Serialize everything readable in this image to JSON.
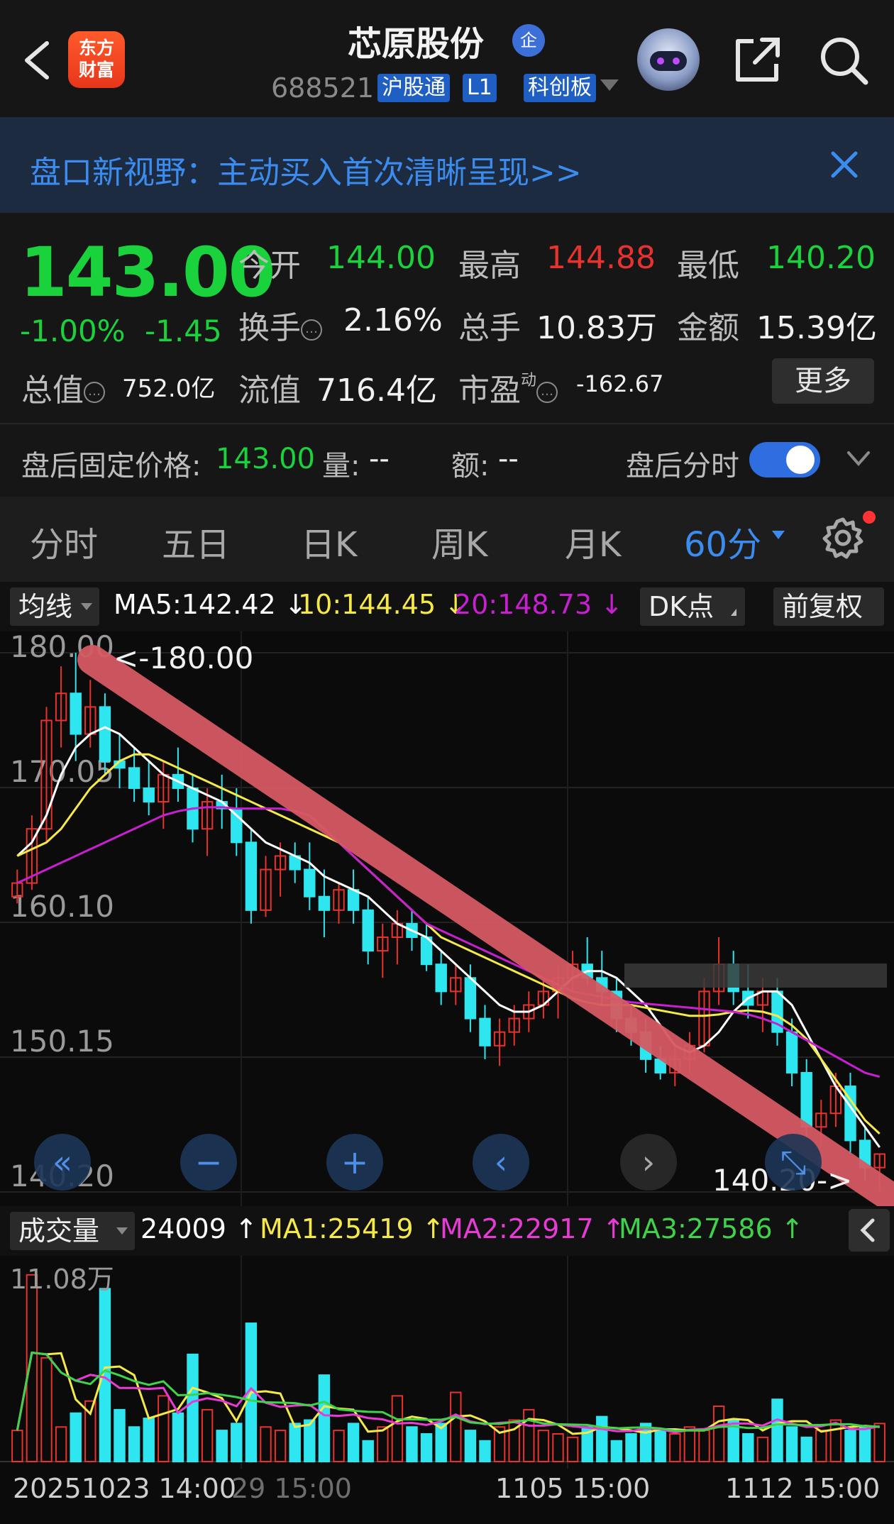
{
  "header": {
    "stock_name": "芯原股份",
    "qi_badge": "企",
    "stock_code": "688521",
    "tags": [
      "沪股通",
      "L1",
      "科创板"
    ],
    "logo_lines": [
      "东方",
      "财富"
    ],
    "icons": [
      "back-icon",
      "robot-avatar-icon",
      "share-icon",
      "search-icon"
    ]
  },
  "banner": {
    "text": "盘口新视野：主动买入首次清晰呈现>>",
    "close_icon": "close-icon"
  },
  "quote": {
    "price": "143.00",
    "change_pct": "-1.00%",
    "change": "-1.45",
    "open_label": "今开",
    "open": "144.00",
    "high_label": "最高",
    "high": "144.88",
    "low_label": "最低",
    "low": "140.20",
    "turnover_label": "换手",
    "turnover": "2.16%",
    "volume_label": "总手",
    "volume": "10.83万",
    "amount_label": "金额",
    "amount": "15.39亿",
    "mktcap_label": "总值",
    "mktcap": "752.0亿",
    "float_label": "流值",
    "float": "716.4亿",
    "pe_label": "市盈",
    "pe_sup": "动",
    "pe": "-162.67",
    "more_label": "更多",
    "colors": {
      "down": "#19d23c",
      "up": "#e8322d"
    }
  },
  "after_hours": {
    "fixed_label": "盘后固定价格:",
    "fixed_price": "143.00",
    "vol_label": "量:",
    "vol": "--",
    "amt_label": "额:",
    "amt": "--",
    "toggle_label": "盘后分时",
    "toggle_on": true
  },
  "tabs": {
    "items": [
      "分时",
      "五日",
      "日K",
      "周K",
      "月K",
      "60分"
    ],
    "active": "60分"
  },
  "ma_bar": {
    "select": "均线",
    "ma5": "MA5:142.42 ↓",
    "ma10": "10:144.45 ↓",
    "ma20": "20:148.73 ↓",
    "dk": "DK点",
    "adjust": "前复权",
    "colors": {
      "ma5": "#ffffff",
      "ma10": "#f5e94a",
      "ma20": "#c81fd1"
    }
  },
  "chart": {
    "y_ticks": [
      "180.00",
      "170.05",
      "160.10",
      "150.15",
      "140.20"
    ],
    "max_marker": "<-180.00",
    "min_marker": "140.20->",
    "nav_icons": [
      "double-left-icon",
      "zoom-out-icon",
      "zoom-in-icon",
      "prev-icon",
      "next-icon",
      "fullscreen-icon"
    ]
  },
  "volume_bar": {
    "select": "成交量",
    "vol": "24009 ↑",
    "ma1": "MA1:25419 ↑",
    "ma2": "MA2:22917 ↑",
    "ma3": "MA3:27586 ↑",
    "max_label": "11.08万",
    "colors": {
      "ma1": "#f5e94a",
      "ma2": "#e83bd4",
      "ma3": "#3fd24a"
    }
  },
  "x_labels": [
    "20251023 14:00",
    "29 15:00",
    "1105 15:00",
    "1112 15:00"
  ],
  "chart_data": {
    "type": "candlestick",
    "ylim": [
      140.2,
      180.0
    ],
    "y_ticks": [
      180.0,
      170.05,
      160.1,
      150.15,
      140.2
    ],
    "candles_ohlc": [
      [
        162,
        164,
        161.5,
        163
      ],
      [
        163,
        168,
        162.5,
        167
      ],
      [
        167,
        176,
        166,
        175
      ],
      [
        175,
        179,
        173,
        177
      ],
      [
        177,
        180,
        172,
        174
      ],
      [
        174,
        178,
        173,
        176
      ],
      [
        176,
        177,
        171,
        172
      ],
      [
        172,
        174,
        170,
        171.5
      ],
      [
        171.5,
        173,
        169,
        170
      ],
      [
        170,
        172,
        168,
        169
      ],
      [
        169,
        172,
        167,
        171
      ],
      [
        171,
        173,
        169,
        170
      ],
      [
        170,
        171,
        166,
        167
      ],
      [
        167,
        170,
        165,
        169
      ],
      [
        169,
        171,
        167,
        168.5
      ],
      [
        168.5,
        170,
        165,
        166
      ],
      [
        166,
        167,
        160,
        161
      ],
      [
        161,
        165,
        160.5,
        164
      ],
      [
        164,
        166,
        162,
        165
      ],
      [
        165,
        166,
        163,
        164
      ],
      [
        164,
        166,
        161,
        162
      ],
      [
        162,
        164,
        159,
        161
      ],
      [
        161,
        163,
        160,
        162.5
      ],
      [
        162.5,
        164,
        160,
        161
      ],
      [
        161,
        162,
        157,
        158
      ],
      [
        158,
        160,
        156,
        159
      ],
      [
        159,
        161,
        157,
        160
      ],
      [
        160,
        161,
        158,
        159
      ],
      [
        159,
        160,
        156.5,
        157
      ],
      [
        157,
        158,
        154,
        155
      ],
      [
        155,
        157,
        154,
        156
      ],
      [
        156,
        157,
        152,
        153
      ],
      [
        153,
        154,
        150,
        151
      ],
      [
        151,
        153,
        149.5,
        152
      ],
      [
        152,
        154,
        151,
        153
      ],
      [
        153,
        155,
        152,
        154
      ],
      [
        154,
        156,
        153,
        155
      ],
      [
        155,
        157,
        153,
        156
      ],
      [
        156,
        158,
        155,
        157
      ],
      [
        157,
        159,
        155.5,
        156
      ],
      [
        156,
        158,
        154,
        155
      ],
      [
        155,
        156,
        152,
        153
      ],
      [
        153,
        154,
        151,
        152
      ],
      [
        152,
        153,
        149,
        150
      ],
      [
        150,
        151,
        148.5,
        149
      ],
      [
        149,
        151,
        148,
        150
      ],
      [
        150,
        152,
        149,
        151
      ],
      [
        151,
        156,
        150.5,
        155
      ],
      [
        155,
        159,
        154,
        157
      ],
      [
        157,
        158,
        154,
        155
      ],
      [
        155,
        157,
        153,
        154
      ],
      [
        154,
        156,
        152,
        155
      ],
      [
        155,
        156,
        151,
        152
      ],
      [
        152,
        153,
        148,
        149
      ],
      [
        149,
        150,
        144,
        145
      ],
      [
        145,
        147,
        143.5,
        146
      ],
      [
        146,
        149,
        145,
        148
      ],
      [
        148,
        149,
        143,
        144
      ],
      [
        144,
        145,
        141,
        142
      ],
      [
        142,
        143,
        140.2,
        143
      ]
    ],
    "series": [
      {
        "name": "MA5",
        "values": [
          165,
          166,
          168,
          171,
          173,
          174,
          174.5,
          174,
          173,
          172,
          171,
          170.5,
          170,
          169.5,
          169,
          168,
          167,
          166,
          165.5,
          165,
          164.5,
          163.5,
          163,
          162.5,
          162,
          161,
          160,
          159.5,
          159,
          158,
          157,
          156,
          155,
          154,
          153.5,
          153.5,
          154,
          155,
          156,
          156.5,
          156.5,
          156,
          155,
          154,
          152.5,
          151,
          150.5,
          151,
          152,
          153.5,
          154.5,
          155,
          155,
          154,
          152,
          150,
          148,
          146.5,
          145,
          143.5
        ]
      },
      {
        "name": "10",
        "values": [
          165,
          165.5,
          166,
          167,
          168.5,
          170,
          171,
          172,
          172.5,
          172.5,
          172,
          171.5,
          171,
          170.5,
          170,
          169.5,
          169,
          168.5,
          168,
          167.5,
          167,
          166.5,
          166,
          165,
          164,
          163,
          162,
          161,
          160,
          159,
          158.5,
          158,
          157.5,
          157,
          156.5,
          156,
          155.5,
          155,
          154.5,
          154.2,
          154,
          154,
          154,
          153.8,
          153.6,
          153.4,
          153.2,
          153.2,
          153.3,
          153.5,
          153.6,
          153.5,
          153.2,
          152.5,
          151.5,
          150,
          148.5,
          147,
          145.5,
          144.5
        ]
      },
      {
        "name": "20",
        "values": [
          163,
          163.5,
          164,
          164.5,
          165,
          165.5,
          166,
          166.5,
          167,
          167.5,
          168,
          168.3,
          168.5,
          168.6,
          168.6,
          168.5,
          168.5,
          168.5,
          168.5,
          168.3,
          168,
          167,
          166,
          165,
          164,
          163,
          162,
          161,
          160,
          159.5,
          159,
          158.5,
          158,
          157.5,
          157,
          156.5,
          156,
          155.5,
          155,
          154.8,
          154.6,
          154.4,
          154.2,
          154.1,
          154,
          153.9,
          153.8,
          153.7,
          153.6,
          153.5,
          153.3,
          153,
          152.6,
          152,
          151.4,
          150.8,
          150.2,
          149.6,
          149,
          148.7
        ]
      }
    ],
    "volume": {
      "max": 110800,
      "ma1": 25419,
      "ma2": 22917,
      "ma3": 27586,
      "values": [
        18000,
        108000,
        60000,
        20000,
        28000,
        35000,
        100000,
        30000,
        20000,
        25000,
        38000,
        28000,
        62000,
        30000,
        18000,
        22000,
        80000,
        20000,
        18000,
        22000,
        24000,
        50000,
        18000,
        22000,
        12000,
        20000,
        38000,
        20000,
        16000,
        22000,
        40000,
        18000,
        12000,
        20000,
        24000,
        30000,
        18000,
        16000,
        14000,
        20000,
        26000,
        12000,
        16000,
        22000,
        18000,
        16000,
        20000,
        18000,
        32000,
        24000,
        16000,
        14000,
        36000,
        20000,
        14000,
        18000,
        24000,
        18000,
        20000,
        22000
      ]
    }
  }
}
